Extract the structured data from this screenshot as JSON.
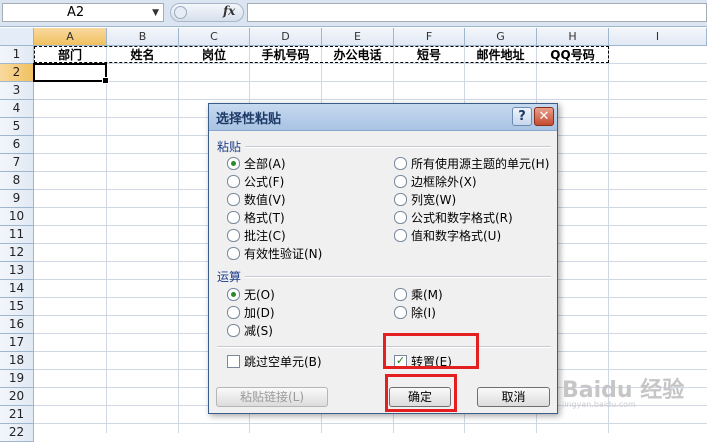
{
  "formula_bar": {
    "name_box": "A2",
    "fx_label": "fx",
    "formula": ""
  },
  "columns": [
    "A",
    "B",
    "C",
    "D",
    "E",
    "F",
    "G",
    "H",
    "I"
  ],
  "rows": [
    "1",
    "2",
    "3",
    "4",
    "5",
    "6",
    "7",
    "8",
    "9",
    "10",
    "11",
    "12",
    "13",
    "14",
    "15",
    "16",
    "17",
    "18",
    "19",
    "20",
    "21",
    "22"
  ],
  "selected_cell": "A2",
  "row1_values": [
    "部门",
    "姓名",
    "岗位",
    "手机号码",
    "办公电话",
    "短号",
    "邮件地址",
    "QQ号码"
  ],
  "dialog": {
    "title": "选择性粘贴",
    "help_label": "?",
    "close_label": "✕",
    "paste_group_label": "粘贴",
    "paste_options": [
      {
        "label": "全部(A)",
        "checked": true
      },
      {
        "label": "公式(F)",
        "checked": false
      },
      {
        "label": "数值(V)",
        "checked": false
      },
      {
        "label": "格式(T)",
        "checked": false
      },
      {
        "label": "批注(C)",
        "checked": false
      },
      {
        "label": "有效性验证(N)",
        "checked": false
      },
      {
        "label": "所有使用源主题的单元(H)",
        "checked": false
      },
      {
        "label": "边框除外(X)",
        "checked": false
      },
      {
        "label": "列宽(W)",
        "checked": false
      },
      {
        "label": "公式和数字格式(R)",
        "checked": false
      },
      {
        "label": "值和数字格式(U)",
        "checked": false
      }
    ],
    "operation_group_label": "运算",
    "operation_options": [
      {
        "label": "无(O)",
        "checked": true
      },
      {
        "label": "加(D)",
        "checked": false
      },
      {
        "label": "减(S)",
        "checked": false
      },
      {
        "label": "乘(M)",
        "checked": false
      },
      {
        "label": "除(I)",
        "checked": false
      }
    ],
    "skip_blanks": {
      "label": "跳过空单元(B)",
      "checked": false
    },
    "transpose": {
      "label": "转置(E)",
      "checked": true
    },
    "paste_link_label": "粘贴链接(L)",
    "ok_label": "确定",
    "cancel_label": "取消"
  },
  "watermark": {
    "brand": "Baidu 经验",
    "url": "jingyan.baidu.com"
  },
  "colors": {
    "highlight_box": "#e41f1f",
    "header_selected": "#f1c15f",
    "dialog_title": "#a9c3e4"
  }
}
